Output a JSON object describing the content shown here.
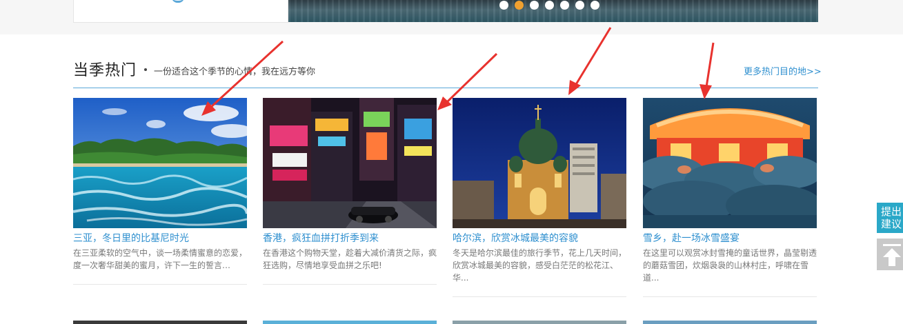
{
  "banner": {
    "dots": 7,
    "active_index": 1
  },
  "section": {
    "title": "当季热门",
    "subtitle": "一份适合这个季节的心情，我在远方等你",
    "more_link": "更多热门目的地>>"
  },
  "cards": [
    {
      "title": "三亚，冬日里的比基尼时光",
      "desc": "在三亚柔软的空气中，谈一场柔情蜜意的恋爱，度一次奢华甜美的蜜月，许下一生的誓言…",
      "image": "sanya-sea-photo"
    },
    {
      "title": "香港，疯狂血拼打折季到来",
      "desc": "在香港这个购物天堂，趁着大减价清货之际，疯狂选购，尽情地享受血拼之乐吧!",
      "image": "hongkong-street-photo"
    },
    {
      "title": "哈尔滨，欣赏冰城最美的容貌",
      "desc": "冬天是哈尔滨最佳的旅行季节，花上几天时间，欣赏冰城最美的容貌，感受白茫茫的松花江、华...",
      "image": "harbin-cathedral-photo"
    },
    {
      "title": "雪乡，赴一场冰雪盛宴",
      "desc": "在这里可以观赏冰封雪掩的童话世界，晶莹剔透的蘑菇雪团，炊烟袅袅的山林村庄，呼啸在雪道...",
      "image": "snow-town-photo"
    }
  ],
  "sidebar": {
    "feedback_label": "提出建议",
    "to_top_icon": "arrow-up-icon"
  },
  "colors": {
    "link_blue": "#2e8fcf",
    "accent_orange": "#f0a030",
    "feedback_teal": "#2aa8c8",
    "annotation_red": "#e8322e"
  }
}
